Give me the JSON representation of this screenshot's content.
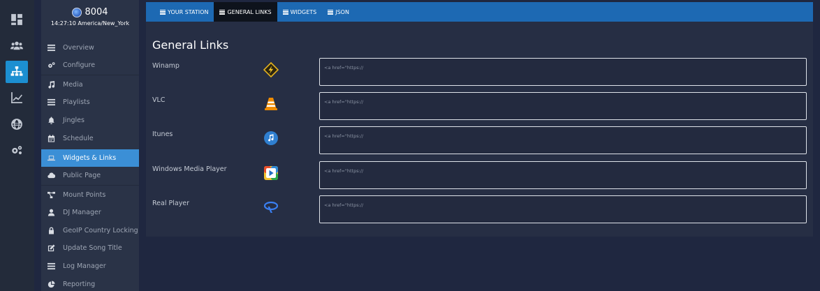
{
  "station": {
    "name": "8004",
    "time": "14:27:10 America/New_York"
  },
  "rail": [
    {
      "icon": "dashboard-icon"
    },
    {
      "icon": "users-icon"
    },
    {
      "icon": "sitemap-icon",
      "active": true
    },
    {
      "icon": "chart-icon"
    },
    {
      "icon": "globe-icon"
    },
    {
      "icon": "gears-icon"
    }
  ],
  "sidebar": {
    "items": [
      {
        "label": "Overview",
        "icon": "list-icon"
      },
      {
        "label": "Configure",
        "icon": "gears-icon"
      },
      {
        "label": "Media",
        "icon": "music-icon"
      },
      {
        "label": "Playlists",
        "icon": "list-icon"
      },
      {
        "label": "Jingles",
        "icon": "bell-icon"
      },
      {
        "label": "Schedule",
        "icon": "calendar-icon"
      },
      {
        "label": "Widgets & Links",
        "icon": "laptop-icon",
        "active": true
      },
      {
        "label": "Public Page",
        "icon": "cloud-icon"
      },
      {
        "label": "Mount Points",
        "icon": "network-icon"
      },
      {
        "label": "DJ Manager",
        "icon": "user-icon"
      },
      {
        "label": "GeoIP Country Locking",
        "icon": "lock-icon"
      },
      {
        "label": "Update Song Title",
        "icon": "edit-icon"
      },
      {
        "label": "Log Manager",
        "icon": "list-icon"
      },
      {
        "label": "Reporting",
        "icon": "pie-chart-icon"
      }
    ]
  },
  "tabs": [
    {
      "label": "YOUR STATION"
    },
    {
      "label": "GENERAL LINKS",
      "active": true
    },
    {
      "label": "WIDGETS"
    },
    {
      "label": "JSON"
    }
  ],
  "page": {
    "title": "General Links"
  },
  "links": [
    {
      "label": "Winamp",
      "icon": "winamp-icon",
      "placeholder": "<a href=\"https://"
    },
    {
      "label": "VLC",
      "icon": "vlc-icon",
      "placeholder": "<a href=\"https://"
    },
    {
      "label": "Itunes",
      "icon": "itunes-icon",
      "placeholder": "<a href=\"https://"
    },
    {
      "label": "Windows Media Player",
      "icon": "windows-media-player-icon",
      "placeholder": "<a href=\"https://"
    },
    {
      "label": "Real Player",
      "icon": "real-player-icon",
      "placeholder": "<a href=\"https://"
    }
  ],
  "colors": {
    "accent": "#1d69b3",
    "active_nav": "#3b8fd6",
    "background": "#1f2740"
  }
}
